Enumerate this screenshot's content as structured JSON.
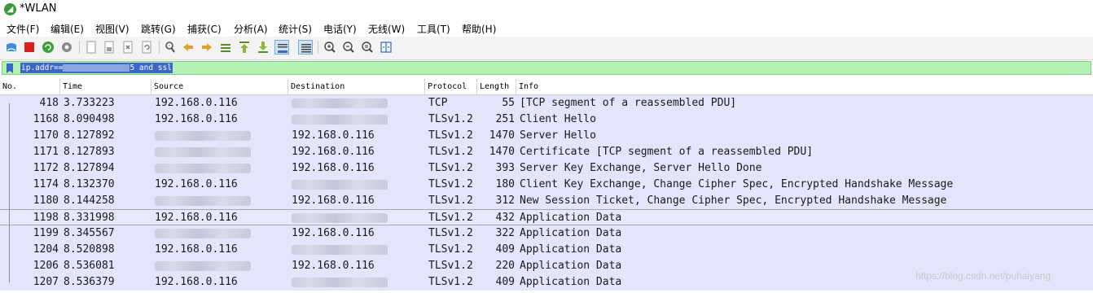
{
  "window": {
    "title": "*WLAN",
    "app_icon": "wireshark-fin-icon"
  },
  "menu": [
    "文件(F)",
    "编辑(E)",
    "视图(V)",
    "跳转(G)",
    "捕获(C)",
    "分析(A)",
    "统计(S)",
    "电话(Y)",
    "无线(W)",
    "工具(T)",
    "帮助(H)"
  ],
  "toolbar": {
    "buttons": [
      "start-capture-icon",
      "stop-capture-icon",
      "restart-capture-icon",
      "capture-options-icon",
      "open-file-icon",
      "save-file-icon",
      "close-file-icon",
      "reload-file-icon",
      "find-packet-icon",
      "go-back-icon",
      "go-forward-icon",
      "go-to-packet-icon",
      "go-first-icon",
      "go-last-icon",
      "autoscroll-icon",
      "colorize-icon",
      "zoom-in-icon",
      "zoom-out-icon",
      "zoom-normal-icon",
      "resize-columns-icon"
    ]
  },
  "filter": {
    "prefix": "ip.addr==",
    "suffix": "5 and ssl",
    "bookmark_icon": "bookmark-icon",
    "color": "#b3f2b3"
  },
  "columns": [
    "No.",
    "Time",
    "Source",
    "Destination",
    "Protocol",
    "Length",
    "Info"
  ],
  "packets": [
    {
      "no": "418",
      "time": "3.733223",
      "source": "192.168.0.116",
      "destination": "",
      "protocol": "TCP",
      "length": "55",
      "info": "[TCP segment of a reassembled PDU]"
    },
    {
      "no": "1168",
      "time": "8.090498",
      "source": "192.168.0.116",
      "destination": "",
      "protocol": "TLSv1.2",
      "length": "251",
      "info": "Client Hello"
    },
    {
      "no": "1170",
      "time": "8.127892",
      "source": "",
      "destination": "192.168.0.116",
      "protocol": "TLSv1.2",
      "length": "1470",
      "info": "Server Hello"
    },
    {
      "no": "1171",
      "time": "8.127893",
      "source": "",
      "destination": "192.168.0.116",
      "protocol": "TLSv1.2",
      "length": "1470",
      "info": "Certificate [TCP segment of a reassembled PDU]"
    },
    {
      "no": "1172",
      "time": "8.127894",
      "source": "",
      "destination": "192.168.0.116",
      "protocol": "TLSv1.2",
      "length": "393",
      "info": "Server Key Exchange, Server Hello Done"
    },
    {
      "no": "1174",
      "time": "8.132370",
      "source": "192.168.0.116",
      "destination": "",
      "protocol": "TLSv1.2",
      "length": "180",
      "info": "Client Key Exchange, Change Cipher Spec, Encrypted Handshake Message"
    },
    {
      "no": "1180",
      "time": "8.144258",
      "source": "",
      "destination": "192.168.0.116",
      "protocol": "TLSv1.2",
      "length": "312",
      "info": "New Session Ticket, Change Cipher Spec, Encrypted Handshake Message"
    },
    {
      "no": "1198",
      "time": "8.331998",
      "source": "192.168.0.116",
      "destination": "",
      "protocol": "TLSv1.2",
      "length": "432",
      "info": "Application Data"
    },
    {
      "no": "1199",
      "time": "8.345567",
      "source": "",
      "destination": "192.168.0.116",
      "protocol": "TLSv1.2",
      "length": "322",
      "info": "Application Data"
    },
    {
      "no": "1204",
      "time": "8.520898",
      "source": "192.168.0.116",
      "destination": "",
      "protocol": "TLSv1.2",
      "length": "409",
      "info": "Application Data"
    },
    {
      "no": "1206",
      "time": "8.536081",
      "source": "",
      "destination": "192.168.0.116",
      "protocol": "TLSv1.2",
      "length": "220",
      "info": "Application Data"
    },
    {
      "no": "1207",
      "time": "8.536379",
      "source": "192.168.0.116",
      "destination": "",
      "protocol": "TLSv1.2",
      "length": "409",
      "info": "Application Data"
    }
  ],
  "selected_row": "1198",
  "watermark": "https://blog.csdn.net/puhaiyang",
  "colors": {
    "row_bg": "#e4e4fc",
    "filter_ok": "#b3f2b3",
    "filter_selection": "#3b67c8"
  }
}
